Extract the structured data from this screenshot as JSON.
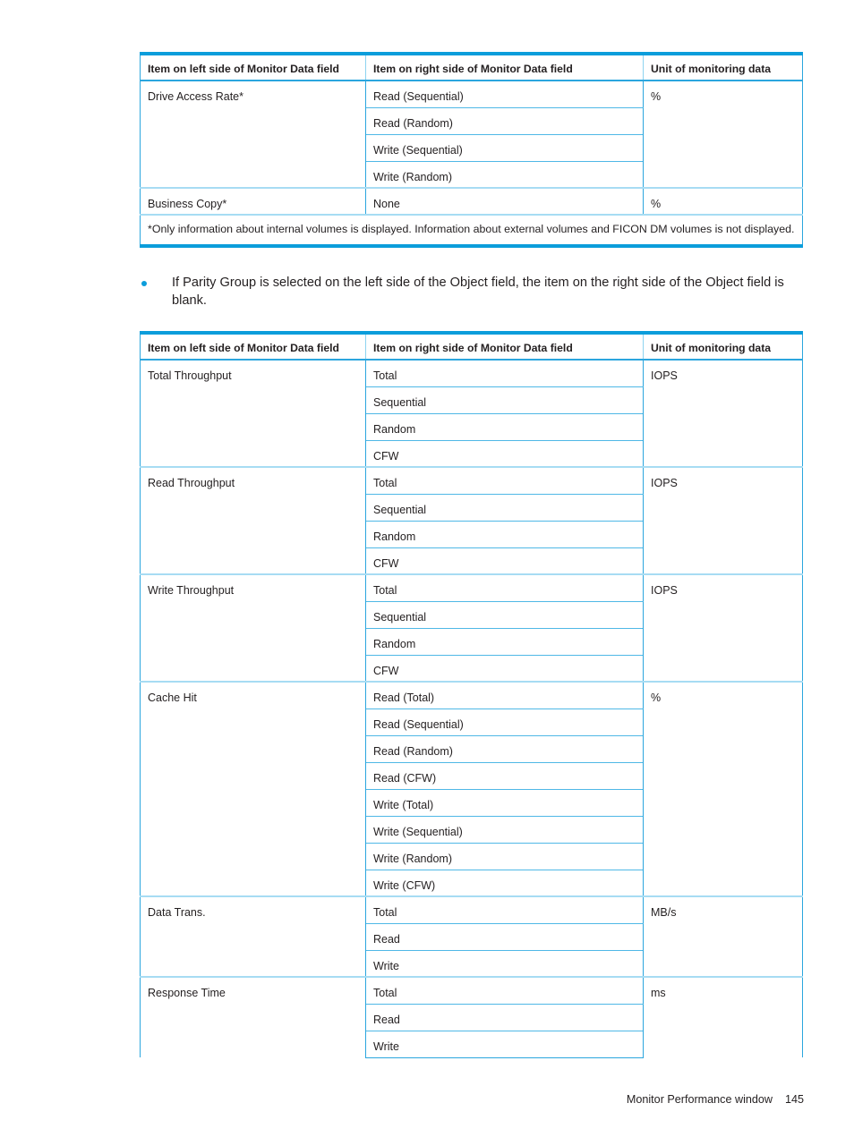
{
  "colors": {
    "accent": "#0b9ddb",
    "rule": "#2ba6de",
    "rule_light": "#a7dcf3",
    "text": "#231f20"
  },
  "table_one": {
    "headers": [
      "Item on left side of Monitor Data field",
      "Item on right side of Monitor Data field",
      "Unit of monitoring data"
    ],
    "groups": [
      {
        "left": "Drive Access Rate*",
        "unit": "%",
        "right": [
          "Read (Sequential)",
          "Read (Random)",
          "Write (Sequential)",
          "Write (Random)"
        ]
      },
      {
        "left": "Business Copy*",
        "unit": "%",
        "right": [
          "None"
        ]
      }
    ],
    "footnote": "*Only information about internal volumes is displayed. Information about external volumes and FICON DM volumes is not displayed."
  },
  "bullet": {
    "marker": "bullet-dot",
    "text": "If Parity Group is selected on the left side of the Object field, the item on the right side of the Object field is blank."
  },
  "table_two": {
    "headers": [
      "Item on left side of Monitor Data field",
      "Item on right side of Monitor Data field",
      "Unit of monitoring data"
    ],
    "groups": [
      {
        "left": "Total Throughput",
        "unit": "IOPS",
        "right": [
          "Total",
          "Sequential",
          "Random",
          "CFW"
        ]
      },
      {
        "left": "Read Throughput",
        "unit": "IOPS",
        "right": [
          "Total",
          "Sequential",
          "Random",
          "CFW"
        ]
      },
      {
        "left": "Write Throughput",
        "unit": "IOPS",
        "right": [
          "Total",
          "Sequential",
          "Random",
          "CFW"
        ]
      },
      {
        "left": "Cache Hit",
        "unit": "%",
        "right": [
          "Read (Total)",
          "Read (Sequential)",
          "Read (Random)",
          "Read (CFW)",
          "Write (Total)",
          "Write (Sequential)",
          "Write (Random)",
          "Write (CFW)"
        ]
      },
      {
        "left": "Data Trans.",
        "unit": "MB/s",
        "right": [
          "Total",
          "Read",
          "Write"
        ]
      },
      {
        "left": "Response Time",
        "unit": "ms",
        "right": [
          "Total",
          "Read",
          "Write"
        ]
      }
    ]
  },
  "footer": {
    "title": "Monitor Performance window",
    "page": "145"
  }
}
